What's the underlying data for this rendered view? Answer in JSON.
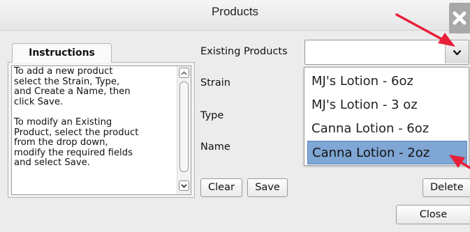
{
  "window": {
    "title": "Products",
    "close_icon": "close-x-icon"
  },
  "instructions": {
    "tab_label": "Instructions",
    "text": "To add a new product\nselect the Strain, Type,\nand Create a Name, then\nclick Save.\n\nTo modify an Existing\nProduct, select the product\nfrom the drop down,\nmodify the required fields\nand select Save."
  },
  "form": {
    "existing_products_label": "Existing Products",
    "existing_products_value": "",
    "strain_label": "Strain",
    "type_label": "Type",
    "name_label": "Name"
  },
  "dropdown": {
    "items": [
      "MJ's Lotion - 6oz",
      "MJ's Lotion - 3 oz",
      "Canna Lotion - 6oz",
      "Canna Lotion - 2oz"
    ],
    "selected_index": 3
  },
  "buttons": {
    "clear": "Clear",
    "save": "Save",
    "delete": "Delete",
    "close": "Close"
  },
  "colors": {
    "annotation_arrow": "#e8203a",
    "selection": "#7fa6d4"
  }
}
